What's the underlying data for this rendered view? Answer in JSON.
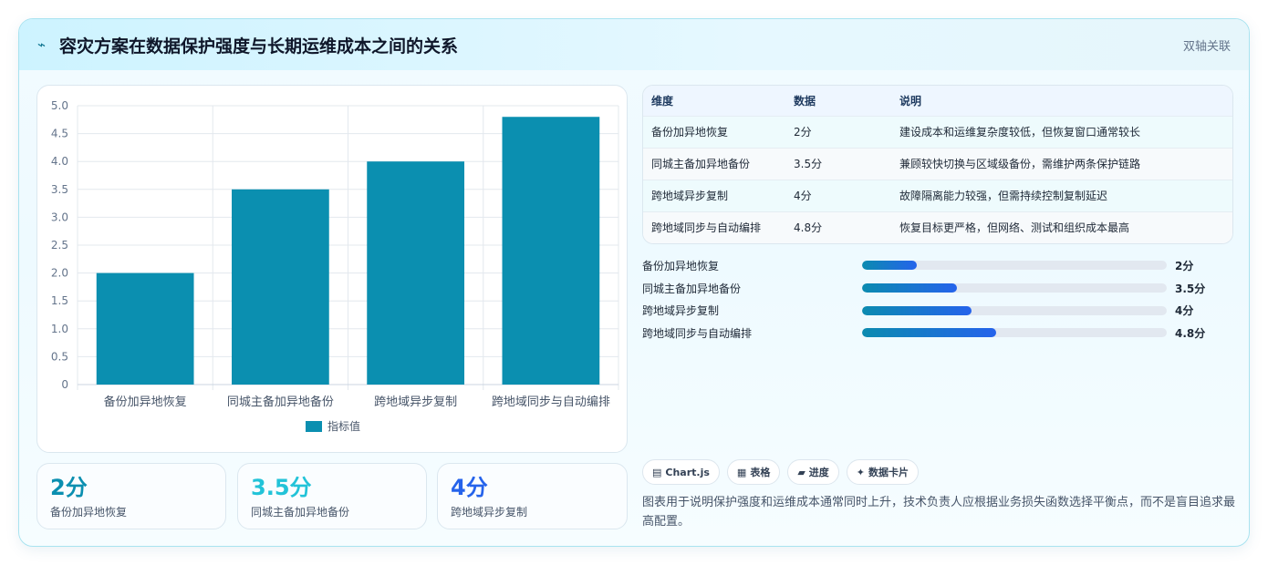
{
  "header": {
    "icon": "signal-icon",
    "title": "容灾方案在数据保护强度与长期运维成本之间的关系",
    "badge": "双轴关联"
  },
  "chart_data": {
    "type": "bar",
    "categories": [
      "备份加异地恢复",
      "同城主备加异地备份",
      "跨地域异步复制",
      "跨地域同步与自动编排"
    ],
    "series": [
      {
        "name": "指标值",
        "values": [
          2,
          3.5,
          4,
          4.8
        ],
        "color": "#0b8fb0"
      }
    ],
    "ylim": [
      0,
      5
    ],
    "yticks": [
      0,
      0.5,
      1,
      1.5,
      2,
      2.5,
      3,
      3.5,
      4,
      4.5,
      5
    ],
    "ytick_labels": [
      "0",
      "0.5",
      "1.0",
      "1.5",
      "2.0",
      "2.5",
      "3.0",
      "3.5",
      "4.0",
      "4.5",
      "5.0"
    ],
    "grid": true,
    "legend": "bottom"
  },
  "kpis": [
    {
      "value": "2分",
      "label": "备份加异地恢复",
      "color": "#0b8fb0"
    },
    {
      "value": "3.5分",
      "label": "同城主备加异地备份",
      "color": "#22c3d8"
    },
    {
      "value": "4分",
      "label": "跨地域异步复制",
      "color": "#2563eb"
    }
  ],
  "table": {
    "headers": [
      "维度",
      "数据",
      "说明"
    ],
    "rows": [
      [
        "备份加异地恢复",
        "2分",
        "建设成本和运维复杂度较低，但恢复窗口通常较长"
      ],
      [
        "同城主备加异地备份",
        "3.5分",
        "兼顾较快切换与区域级备份，需维护两条保护链路"
      ],
      [
        "跨地域异步复制",
        "4分",
        "故障隔离能力较强，但需持续控制复制延迟"
      ],
      [
        "跨地域同步与自动编排",
        "4.8分",
        "恢复目标更严格，但网络、测试和组织成本最高"
      ]
    ]
  },
  "progress": [
    {
      "label": "备份加异地恢复",
      "value": "2分",
      "fraction": 0.18
    },
    {
      "label": "同城主备加异地备份",
      "value": "3.5分",
      "fraction": 0.31
    },
    {
      "label": "跨地域异步复制",
      "value": "4分",
      "fraction": 0.36
    },
    {
      "label": "跨地域同步与自动编排",
      "value": "4.8分",
      "fraction": 0.44
    }
  ],
  "chips": [
    {
      "icon": "chart-icon",
      "glyph": "▤",
      "label": "Chart.js"
    },
    {
      "icon": "table-icon",
      "glyph": "▦",
      "label": "表格"
    },
    {
      "icon": "progress-icon",
      "glyph": "▰",
      "label": "进度"
    },
    {
      "icon": "sparkle-icon",
      "glyph": "✦",
      "label": "数据卡片"
    }
  ],
  "note": "图表用于说明保护强度和运维成本通常同时上升，技术负责人应根据业务损失函数选择平衡点，而不是盲目追求最高配置。"
}
